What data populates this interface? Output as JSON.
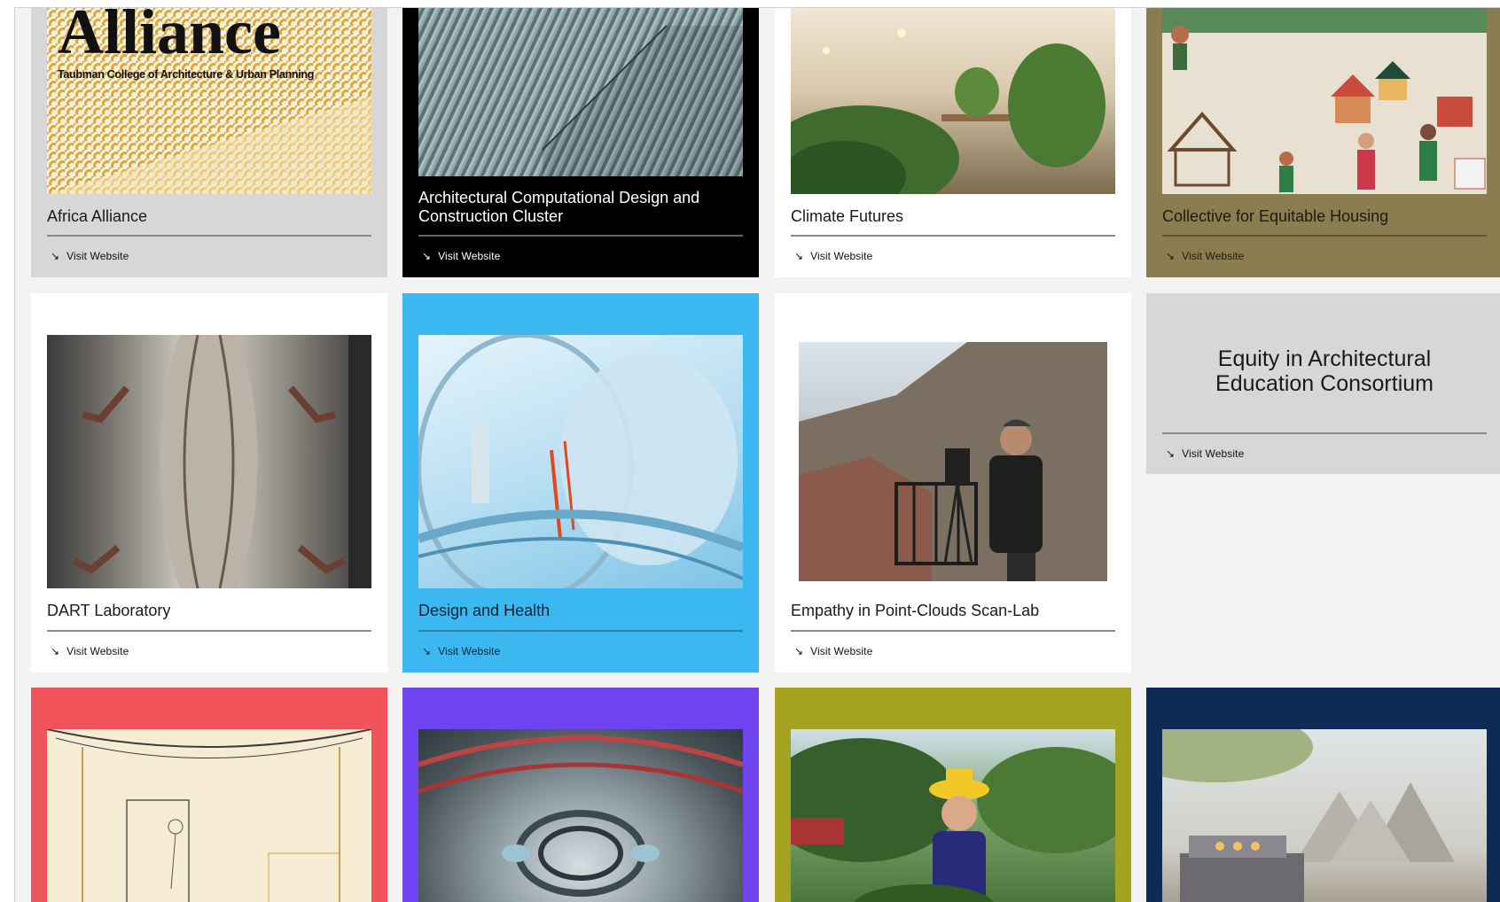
{
  "colors": {
    "page_bg": "#f3f3f3",
    "light_card": "#d7d7d7",
    "white_card": "#ffffff",
    "black_card": "#000000",
    "olive_card": "#8a7d50",
    "blue_card": "#3bb8f0",
    "red_card": "#f0545a",
    "purple_card": "#6e44f0",
    "lime_card": "#a3a31f",
    "navy_card": "#0c2b57"
  },
  "cards": [
    {
      "title": "Africa Alliance",
      "visit": "Visit Website",
      "hero_text": "Alliance",
      "hero_subtext": "Taubman College of Architecture & Urban Planning"
    },
    {
      "title": "Architectural Computational Design and Construction Cluster",
      "visit": "Visit Website"
    },
    {
      "title": "Climate Futures",
      "visit": "Visit Website"
    },
    {
      "title": "Collective for Equitable Housing",
      "visit": "Visit Website"
    },
    {
      "title": "DART Laboratory",
      "visit": "Visit Website"
    },
    {
      "title": "Design and Health",
      "visit": "Visit Website"
    },
    {
      "title": "Empathy in Point-Clouds Scan-Lab",
      "visit": "Visit Website"
    },
    {
      "title": "Equity in Architectural Education Consortium",
      "visit": "Visit Website"
    }
  ],
  "icons": {
    "visit_arrow": "south-east-arrow-icon"
  }
}
